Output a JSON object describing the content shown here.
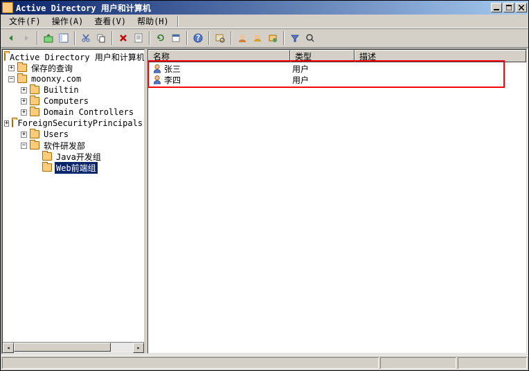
{
  "title": "Active Directory 用户和计算机",
  "menu": {
    "file": "文件(F)",
    "action": "操作(A)",
    "view": "查看(V)",
    "help": "帮助(H)"
  },
  "tree": {
    "root": "Active Directory 用户和计算机",
    "saved_queries": "保存的查询",
    "domain": "moonxy.com",
    "builtin": "Builtin",
    "computers": "Computers",
    "domain_controllers": "Domain Controllers",
    "fsp": "ForeignSecurityPrincipals",
    "users": "Users",
    "dept": "软件研发部",
    "java_group": "Java开发组",
    "web_group": "Web前端组"
  },
  "columns": {
    "name": "名称",
    "type": "类型",
    "desc": "描述"
  },
  "rows": [
    {
      "name": "张三",
      "type": "用户",
      "desc": ""
    },
    {
      "name": "李四",
      "type": "用户",
      "desc": ""
    }
  ],
  "col_widths": {
    "name": 205,
    "type": 93,
    "desc": 200
  }
}
